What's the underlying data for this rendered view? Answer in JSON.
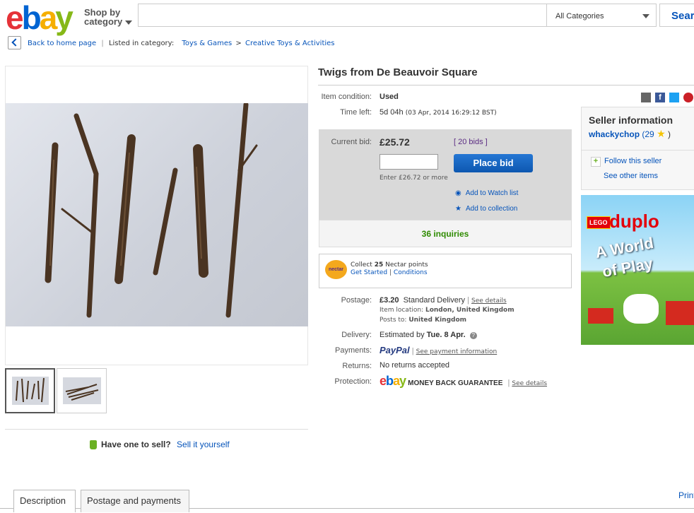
{
  "header": {
    "logo": [
      "e",
      "b",
      "a",
      "y"
    ],
    "shop_by": [
      "Shop by",
      "category"
    ],
    "category": "All Categories",
    "search_label": "Sear"
  },
  "breadcrumb": {
    "back": "Back to home page",
    "listed": "Listed in category:",
    "cat1": "Toys & Games",
    "sep": ">",
    "cat2": "Creative Toys & Activities"
  },
  "listing": {
    "title": "Twigs from De Beauvoir Square",
    "condition_label": "Item condition:",
    "condition": "Used",
    "time_left_label": "Time left:",
    "time_left": "5d 04h",
    "end_time": "(03 Apr, 2014  16:29:12 BST)",
    "current_bid_label": "Current bid:",
    "current_bid": "£25.72",
    "bids": "[ 20 bids ]",
    "bid_hint": "Enter £26.72 or more",
    "place_bid": "Place bid",
    "watch": "Add to Watch list",
    "collection": "Add to collection",
    "inquiries": "36 inquiries",
    "nectar_logo": "nectar",
    "nectar_collect": "Collect",
    "nectar_points": "25",
    "nectar_text": "Nectar points",
    "get_started": "Get Started",
    "conditions": "Conditions",
    "postage_label": "Postage:",
    "postage_price": "£3.20",
    "postage_type": "Standard Delivery",
    "see_details": "See details",
    "item_location": "Item location:",
    "location": "London, United Kingdom",
    "posts_to_label": "Posts to:",
    "posts_to": "United Kingdom",
    "delivery_label": "Delivery:",
    "delivery_est": "Estimated by",
    "delivery_date": "Tue. 8 Apr.",
    "payments_label": "Payments:",
    "paypal": "PayPal",
    "payment_info": "See payment information",
    "returns_label": "Returns:",
    "returns": "No returns accepted",
    "protection_label": "Protection:",
    "mbg": "MONEY BACK GUARANTEE",
    "mbg_details": "See details"
  },
  "seller": {
    "heading": "Seller information",
    "name": "whackychop",
    "score": "(29",
    "close": ")",
    "follow": "Follow this seller",
    "see_other": "See other items"
  },
  "ad": {
    "brand": "LEGO",
    "line": "duplo",
    "slogan1": "A World",
    "slogan2": "of Play"
  },
  "sell": {
    "question": "Have one to sell?",
    "link": "Sell it yourself"
  },
  "tabs": [
    "Description",
    "Postage and payments"
  ],
  "print": "Print",
  "colors": {
    "link": "#0654ba",
    "place_bid": "#0d57b0",
    "inquiries": "#2e8b00"
  }
}
